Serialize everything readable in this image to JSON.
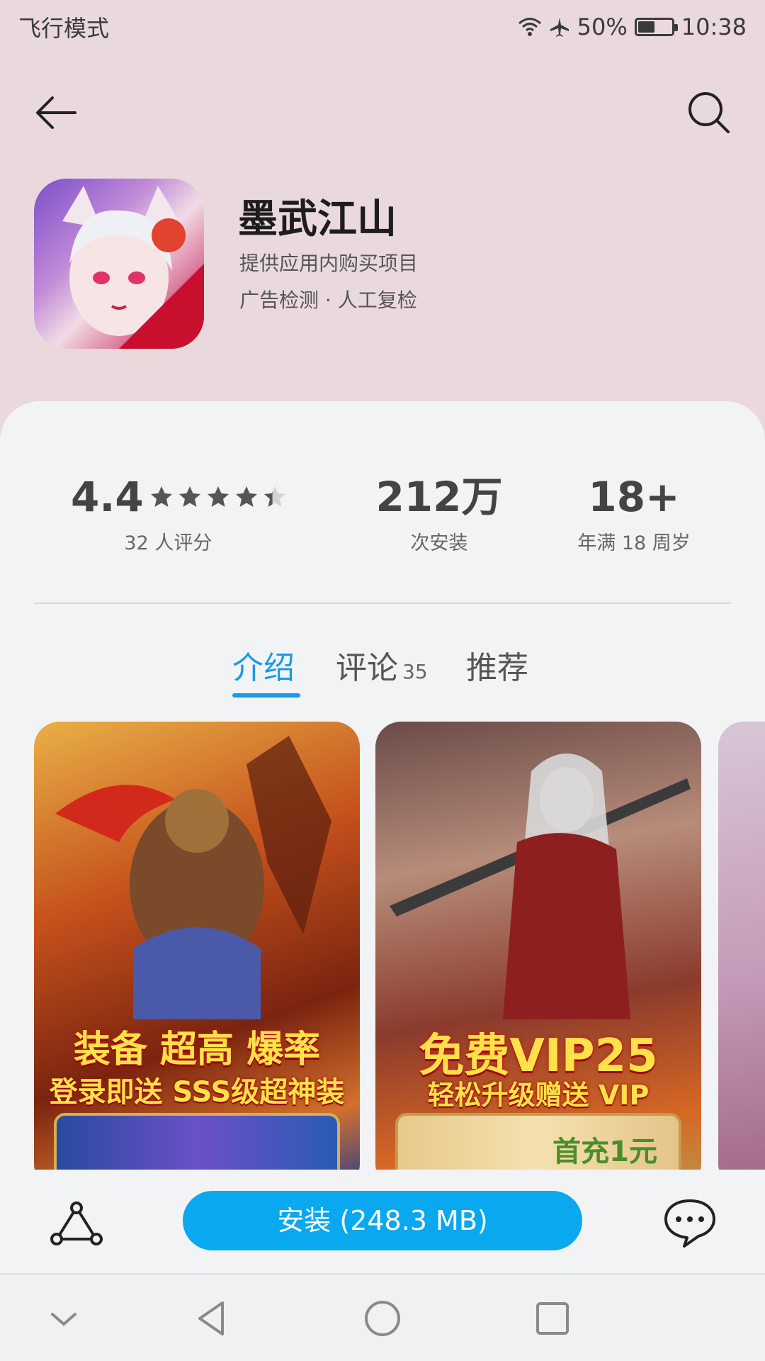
{
  "status_bar": {
    "mode": "飞行模式",
    "battery": "50%",
    "time": "10:38"
  },
  "app": {
    "name": "墨武江山",
    "subtitle_1": "提供应用内购买项目",
    "subtitle_2": "广告检测 · 人工复检"
  },
  "stats": {
    "rating_value": "4.4",
    "rating_label": "32 人评分",
    "stars_filled": 4.4,
    "installs_value": "212万",
    "installs_label": "次安装",
    "age_value": "18+",
    "age_label": "年满 18 周岁"
  },
  "tabs": [
    {
      "label": "介绍",
      "count": ""
    },
    {
      "label": "评论",
      "count": "35"
    },
    {
      "label": "推荐",
      "count": ""
    }
  ],
  "screenshots": [
    {
      "line1": "装备 超高 爆率",
      "line2": "登录即送 SSS级超神装"
    },
    {
      "line1": "免费VIP25",
      "line2": "轻松升级赠送 VIP",
      "banner": "首充1元"
    }
  ],
  "install_button": "安装 (248.3 MB)",
  "colors": {
    "accent": "#1a9ae6",
    "install": "#0aa8ee",
    "header_bg": "#ead9dc",
    "card_bg": "#f2f3f5"
  }
}
